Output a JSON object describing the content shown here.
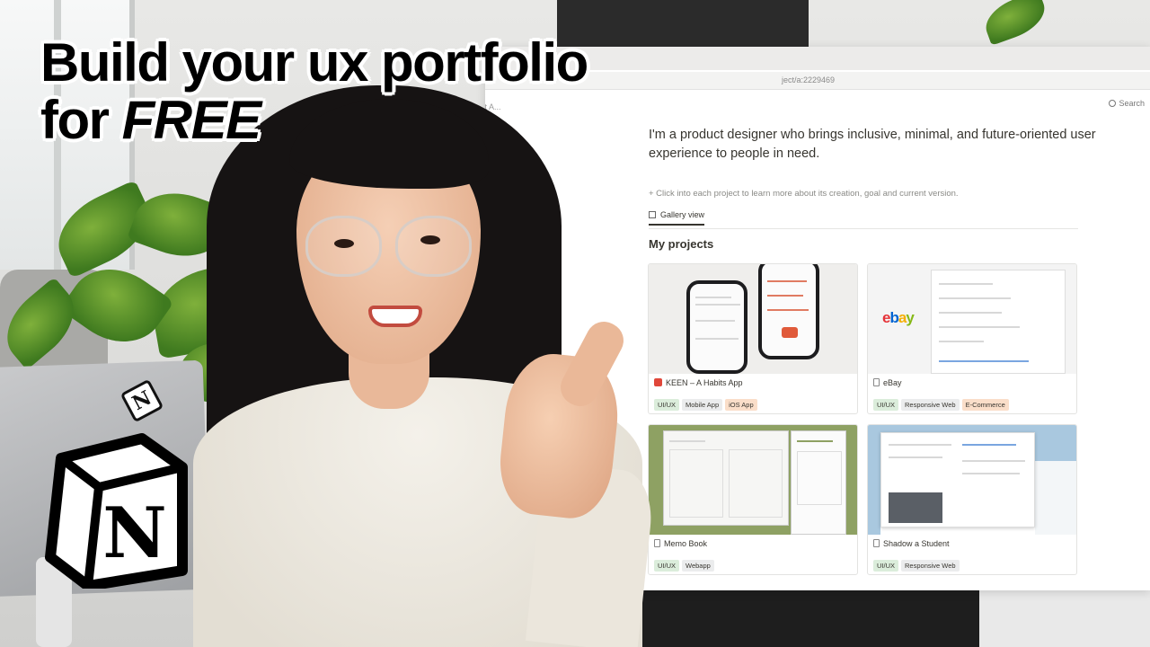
{
  "headline": {
    "line1": "Build your ux portfolio",
    "line2_prefix": "for ",
    "line2_emphasis": "FREE"
  },
  "notion_page": {
    "url_fragment": "ject/a:2229469",
    "breadcrumb": "ild Pit A...",
    "search_label": "Search",
    "intro": "I'm a product designer who brings inclusive, minimal, and future-oriented user experience to people in need.",
    "hint": "+ Click into each project to learn more about its creation, goal and current version.",
    "view_tab": "Gallery view",
    "section_title": "My projects",
    "cards": [
      {
        "title": "KEEN – A Habits App",
        "icon": "calendar-icon",
        "tags": [
          {
            "label": "UI/UX",
            "color": "green"
          },
          {
            "label": "Mobile App",
            "color": "gray"
          },
          {
            "label": "iOS App",
            "color": "orange"
          }
        ]
      },
      {
        "title": "eBay",
        "icon": "page-icon",
        "cover_logo": "ebay",
        "tags": [
          {
            "label": "UI/UX",
            "color": "green"
          },
          {
            "label": "Responsive Web",
            "color": "gray"
          },
          {
            "label": "E-Commerce",
            "color": "orange"
          }
        ]
      },
      {
        "title": "Memo Book",
        "icon": "page-icon",
        "tags": [
          {
            "label": "UI/UX",
            "color": "green"
          },
          {
            "label": "Webapp",
            "color": "gray"
          }
        ]
      },
      {
        "title": "Shadow a Student",
        "icon": "page-icon",
        "tags": [
          {
            "label": "UI/UX",
            "color": "green"
          },
          {
            "label": "Responsive Web",
            "color": "gray"
          }
        ]
      }
    ]
  },
  "logo": {
    "letter": "N",
    "sticker_letter": "N"
  },
  "colors": {
    "headline_text": "#000000",
    "headline_outline": "#ffffff",
    "tag_green": "#dbeddb",
    "tag_gray": "#ebeced",
    "tag_orange": "#fadec9",
    "memo_cover": "#8ea163",
    "shadow_cover": "#a9c8df"
  }
}
